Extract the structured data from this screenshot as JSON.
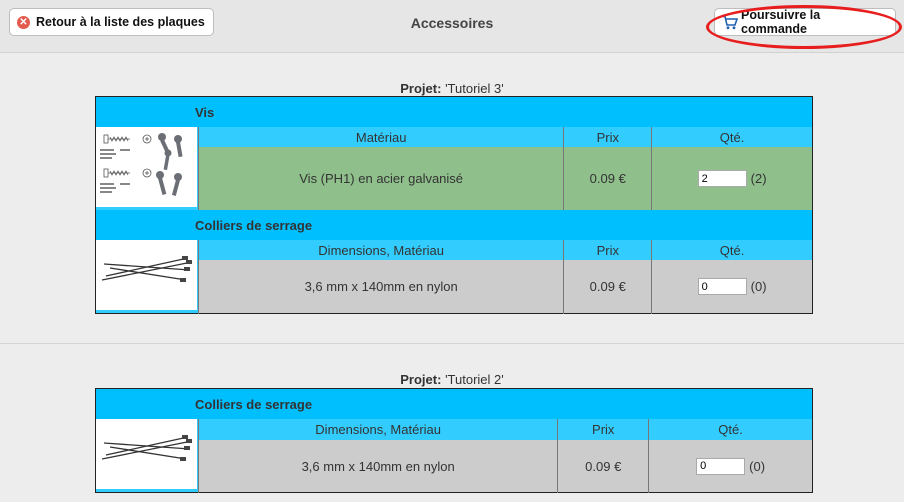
{
  "header": {
    "back_label": "Retour à la liste des plaques",
    "title": "Accessoires",
    "continue_label": "Poursuivre la commande"
  },
  "colors": {
    "category": "#00bfff",
    "column_header": "#33ccff",
    "row_selected": "#8fbf8a",
    "row_default": "#cccccc"
  },
  "projects": [
    {
      "label": "Projet:",
      "name": "'Tutoriel 3'",
      "groups": [
        {
          "category": "Vis",
          "image": "screw-diagram-image",
          "columns": {
            "spec": "Matériau",
            "price": "Prix",
            "qty": "Qté."
          },
          "item": {
            "description": "Vis (PH1) en acier galvanisé",
            "price": "0.09 €",
            "qty": "2",
            "qty_note": "(2)"
          }
        },
        {
          "category": "Colliers de serrage",
          "image": "cable-ties-image",
          "columns": {
            "spec": "Dimensions, Matériau",
            "price": "Prix",
            "qty": "Qté."
          },
          "item": {
            "description": "3,6 mm x 140mm en nylon",
            "price": "0.09 €",
            "qty": "0",
            "qty_note": "(0)"
          }
        }
      ]
    },
    {
      "label": "Projet:",
      "name": "'Tutoriel 2'",
      "groups": [
        {
          "category": "Colliers de serrage",
          "image": "cable-ties-image",
          "columns": {
            "spec": "Dimensions, Matériau",
            "price": "Prix",
            "qty": "Qté."
          },
          "item": {
            "description": "3,6 mm x 140mm en nylon",
            "price": "0.09 €",
            "qty": "0",
            "qty_note": "(0)"
          }
        }
      ]
    }
  ]
}
